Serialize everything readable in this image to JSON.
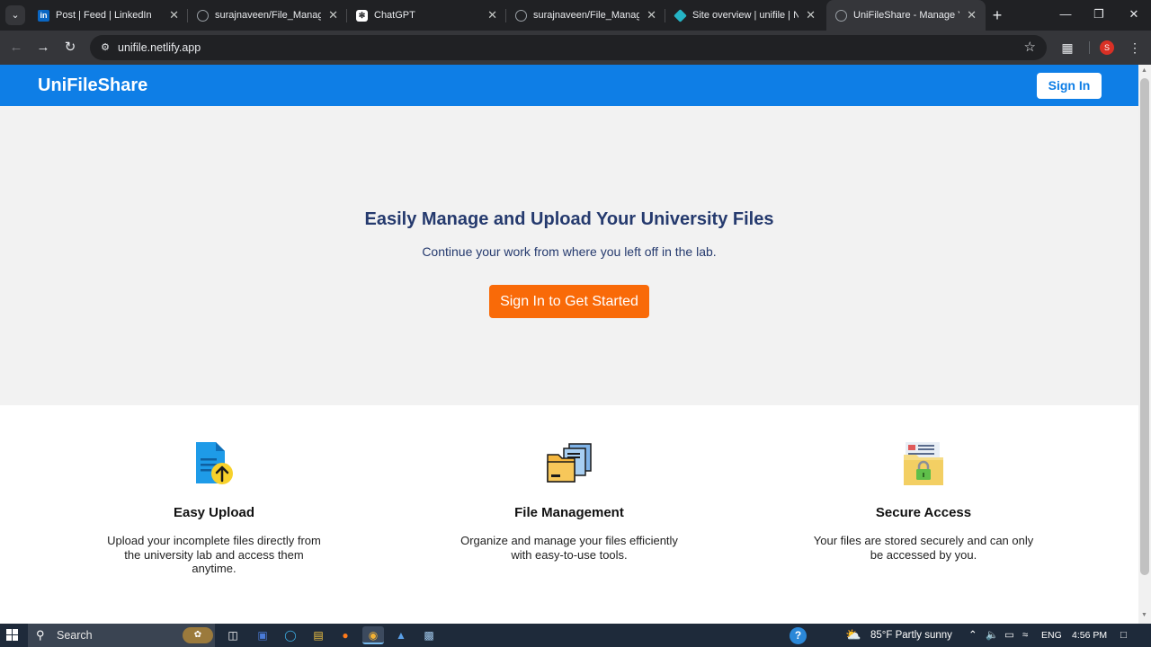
{
  "browser": {
    "tabs": [
      {
        "label": "Post | Feed | LinkedIn",
        "favicon": "linkedin-icon",
        "active": false
      },
      {
        "label": "surajnaveen/File_Managem",
        "favicon": "github-icon",
        "active": false
      },
      {
        "label": "ChatGPT",
        "favicon": "chatgpt-icon",
        "active": false
      },
      {
        "label": "surajnaveen/File_Managem",
        "favicon": "github-icon",
        "active": false
      },
      {
        "label": "Site overview | unifile | Net",
        "favicon": "netlify-icon",
        "active": false
      },
      {
        "label": "UniFileShare - Manage You",
        "favicon": "globe-icon",
        "active": true
      }
    ],
    "url": "unifile.netlify.app",
    "profile_initial": "S"
  },
  "site": {
    "brand": "UniFileShare",
    "header_signin_label": "Sign In",
    "hero": {
      "title": "Easily Manage and Upload Your University Files",
      "subtitle": "Continue your work from where you left off in the lab.",
      "cta_label": "Sign In to Get Started"
    },
    "features": [
      {
        "icon": "file-upload-icon",
        "title": "Easy Upload",
        "description": "Upload your incomplete files directly from the university lab and access them anytime."
      },
      {
        "icon": "folder-files-icon",
        "title": "File Management",
        "description": "Organize and manage your files efficiently with easy-to-use tools."
      },
      {
        "icon": "secure-folder-lock-icon",
        "title": "Secure Access",
        "description": "Your files are stored securely and can only be accessed by you."
      }
    ]
  },
  "taskbar": {
    "search_placeholder": "Search",
    "weather": "85°F  Partly sunny",
    "language": "ENG",
    "time": "4:56 PM"
  },
  "colors": {
    "header_blue": "#0e7ee6",
    "cta_orange": "#f96a08",
    "hero_bg": "#f2f2f2",
    "title_navy": "#253a6e"
  }
}
